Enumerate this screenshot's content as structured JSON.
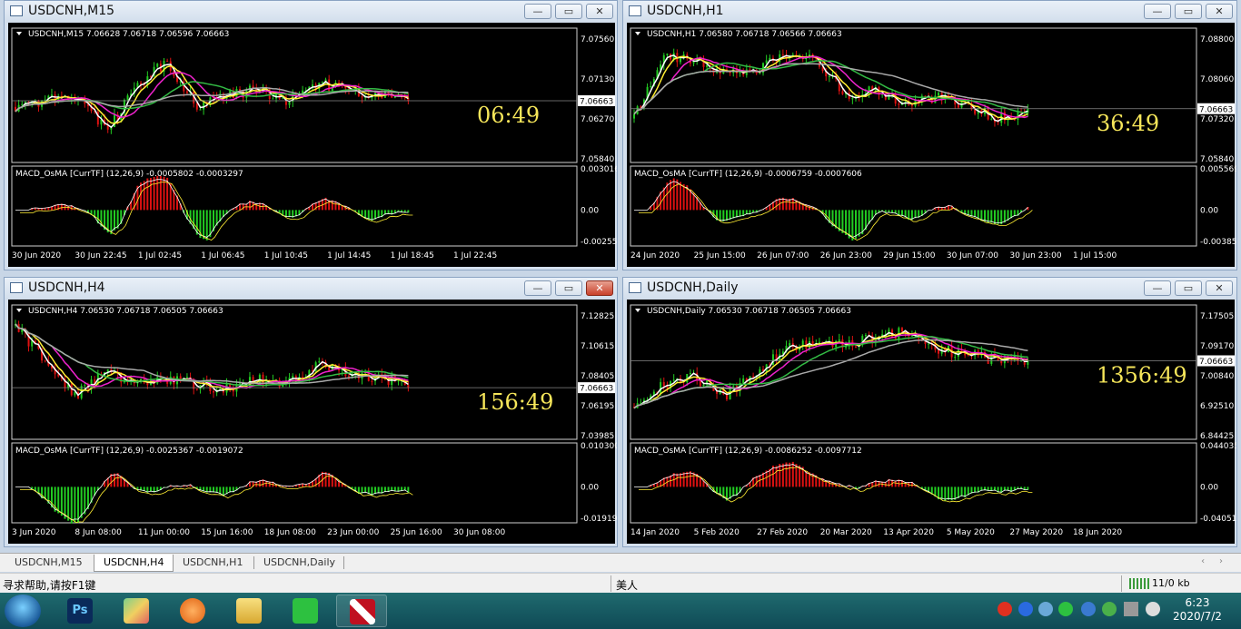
{
  "windows": [
    {
      "title": "USDCNH,M15",
      "info": "USDCNH,M15  7.06628 7.06718 7.06596 7.06663",
      "macd": "MACD_OsMA [CurrTF] (12,26,9) -0.0005802 -0.0003297",
      "timer": "06:49",
      "current_price": "7.06663",
      "price_ticks": [
        "7.07560",
        "7.07130",
        "7.06270",
        "7.05840"
      ],
      "macd_ticks": [
        "0.0030168",
        "0.00",
        "-0.002552"
      ],
      "time_ticks": [
        "30 Jun 2020",
        "30 Jun 22:45",
        "1 Jul 02:45",
        "1 Jul 06:45",
        "1 Jul 10:45",
        "1 Jul 14:45",
        "1 Jul 18:45",
        "1 Jul 22:45"
      ]
    },
    {
      "title": "USDCNH,H1",
      "info": "USDCNH,H1  7.06580 7.06718 7.06566 7.06663",
      "macd": "MACD_OsMA [CurrTF] (12,26,9) -0.0006759 -0.0007606",
      "timer": "36:49",
      "current_price": "7.06663",
      "price_ticks": [
        "7.08800",
        "7.08060",
        "7.07320",
        "7.05840"
      ],
      "macd_ticks": [
        "0.0055694",
        "0.00",
        "-0.003852"
      ],
      "time_ticks": [
        "24 Jun 2020",
        "25 Jun 15:00",
        "26 Jun 07:00",
        "26 Jun 23:00",
        "29 Jun 15:00",
        "30 Jun 07:00",
        "30 Jun 23:00",
        "1 Jul 15:00"
      ]
    },
    {
      "title": "USDCNH,H4",
      "info": "USDCNH,H4  7.06530 7.06718 7.06505 7.06663",
      "macd": "MACD_OsMA [CurrTF] (12,26,9) -0.0025367 -0.0019072",
      "timer": "156:49",
      "current_price": "7.06663",
      "price_ticks": [
        "7.12825",
        "7.10615",
        "7.08405",
        "7.06195",
        "7.03985"
      ],
      "macd_ticks": [
        "0.0103008",
        "0.00",
        "-0.019195"
      ],
      "time_ticks": [
        "3 Jun 2020",
        "8 Jun 08:00",
        "11 Jun 00:00",
        "15 Jun 16:00",
        "18 Jun 08:00",
        "23 Jun 00:00",
        "25 Jun 16:00",
        "30 Jun 08:00"
      ]
    },
    {
      "title": "USDCNH,Daily",
      "info": "USDCNH,Daily  7.06530 7.06718 7.06505 7.06663",
      "macd": "MACD_OsMA [CurrTF] (12,26,9) -0.0086252 -0.0097712",
      "timer": "1356:49",
      "current_price": "7.06663",
      "price_ticks": [
        "7.17505",
        "7.09170",
        "7.00840",
        "6.92510",
        "6.84425"
      ],
      "macd_ticks": [
        "0.0440354",
        "0.00",
        "-0.040514"
      ],
      "time_ticks": [
        "14 Jan 2020",
        "5 Feb 2020",
        "27 Feb 2020",
        "20 Mar 2020",
        "13 Apr 2020",
        "5 May 2020",
        "27 May 2020",
        "18 Jun 2020"
      ]
    }
  ],
  "tabs": [
    "USDCNH,M15",
    "USDCNH,H4",
    "USDCNH,H1",
    "USDCNH,Daily"
  ],
  "active_tab": "USDCNH,H4",
  "status": {
    "help": "寻求帮助,请按F1键",
    "profile": "美人",
    "traffic": "11/0 kb"
  },
  "clock": {
    "time": "6:23",
    "date": "2020/7/2"
  },
  "colors": {
    "bull": "#22cc22",
    "bear": "#dd1111",
    "ma_white": "#ffffff",
    "ma_yellow": "#ffee33",
    "ma_magenta": "#ee22cc",
    "ma_green": "#33bb44",
    "ma_gray": "#aaaaaa",
    "timer": "#f6e65a"
  }
}
